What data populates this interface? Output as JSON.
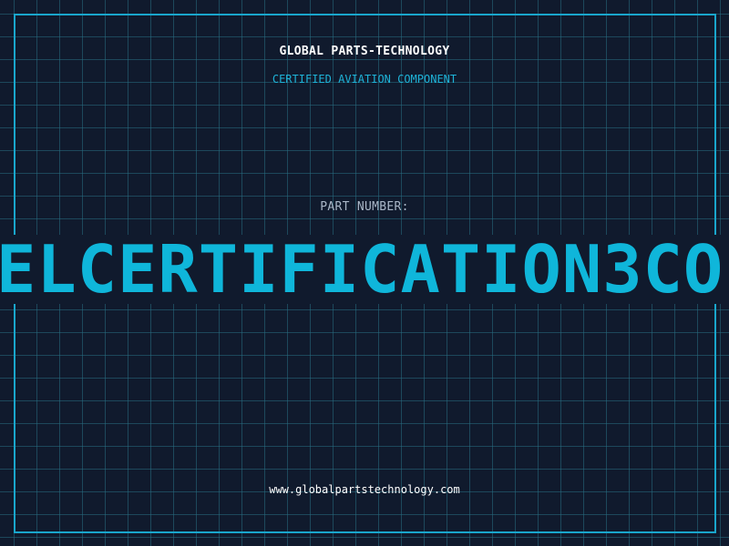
{
  "header": {
    "company": "GLOBAL PARTS-TECHNOLOGY",
    "subtitle": "CERTIFIED AVIATION COMPONENT"
  },
  "part": {
    "label": "PART NUMBER:",
    "value": "ELCERTIFICATION3CO"
  },
  "footer": {
    "url": "www.globalpartstechnology.com"
  },
  "colors": {
    "background": "#101a2d",
    "accent": "#19a6cc",
    "part_number": "#0fb6da",
    "grid": "#286e82"
  }
}
